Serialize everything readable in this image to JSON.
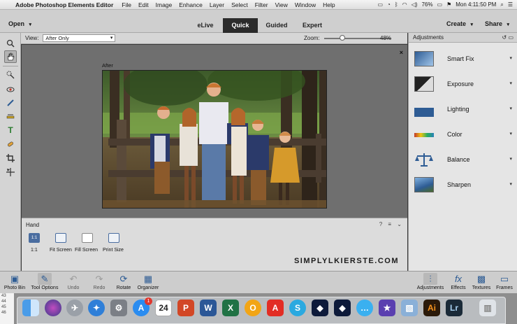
{
  "menubar": {
    "app_name": "Adobe Photoshop Elements Editor",
    "items": [
      "File",
      "Edit",
      "Image",
      "Enhance",
      "Layer",
      "Select",
      "Filter",
      "View",
      "Window",
      "Help"
    ],
    "battery": "76%",
    "clock": "Mon 4:11:50 PM"
  },
  "header": {
    "open_label": "Open",
    "tabs": [
      {
        "label": "eLive",
        "active": false
      },
      {
        "label": "Quick",
        "active": true
      },
      {
        "label": "Guided",
        "active": false
      },
      {
        "label": "Expert",
        "active": false
      }
    ],
    "create_label": "Create",
    "share_label": "Share"
  },
  "options_bar": {
    "view_label": "View:",
    "view_value": "After Only",
    "zoom_label": "Zoom:",
    "zoom_value": "48%",
    "zoom_fraction": 0.25
  },
  "canvas": {
    "after_label": "After",
    "close_glyph": "×"
  },
  "tool_options": {
    "tool_name": "Hand",
    "buttons": [
      {
        "label": "1:1",
        "caption": "1:1"
      },
      {
        "label": "",
        "caption": "Fit Screen"
      },
      {
        "label": "",
        "caption": "Fill Screen"
      },
      {
        "label": "",
        "caption": "Print Size"
      }
    ],
    "watermark": "SIMPLYLKIERSTE.COM"
  },
  "adjustments": {
    "title": "Adjustments",
    "items": [
      "Smart Fix",
      "Exposure",
      "Lighting",
      "Color",
      "Balance",
      "Sharpen"
    ]
  },
  "bottom_bar": {
    "left": [
      "Photo Bin",
      "Tool Options",
      "Undo",
      "Redo",
      "Rotate",
      "Organizer"
    ],
    "right": [
      "Adjustments",
      "Effects",
      "Textures",
      "Frames"
    ]
  },
  "dock": {
    "calendar_day": "24",
    "badge": "1",
    "sheet_rows": [
      "43",
      "44",
      "45",
      "46"
    ],
    "apps": [
      "Finder",
      "Siri",
      "Launchpad",
      "Safari",
      "System Preferences",
      "App Store",
      "Calendar",
      "PowerPoint",
      "Word",
      "Excel",
      "Office",
      "Acrobat",
      "Skype",
      "Premiere Elements",
      "Photoshop Elements",
      "Messages",
      "iMovie",
      "Preview",
      "Illustrator",
      "Lightroom",
      "Trash"
    ]
  },
  "colors": {
    "accent": "#4a6da0",
    "active_tab_bg": "#2b2b2b"
  }
}
